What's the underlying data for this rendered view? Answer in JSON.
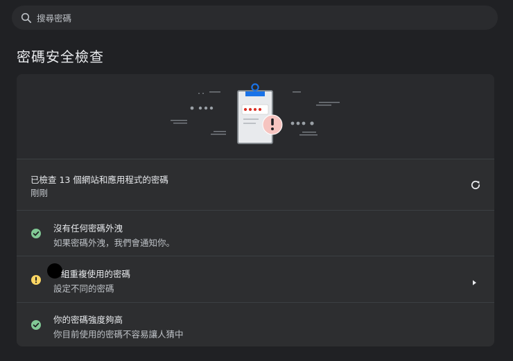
{
  "search": {
    "placeholder": "搜尋密碼",
    "icon": "search-icon"
  },
  "page_title": "密碼安全檢查",
  "summary": {
    "checked_text": "已檢查 13 個網站和應用程式的密碼",
    "time_text": "剛剛",
    "icon": "refresh-icon"
  },
  "items": [
    {
      "title": "沒有任何密碼外洩",
      "subtitle": "如果密碼外洩，我們會通知你。",
      "status": "ok",
      "icon": "check-circle-icon"
    },
    {
      "title": "組重複使用的密碼",
      "subtitle": "設定不同的密碼",
      "status": "warning",
      "icon": "warning-circle-icon"
    },
    {
      "title": "你的密碼強度夠高",
      "subtitle": "你目前使用的密碼不容易讓人猜中",
      "status": "ok",
      "icon": "check-circle-icon"
    }
  ],
  "colors": {
    "background": "#202124",
    "card": "#2d2e30",
    "ok": "#81c995",
    "warning": "#fdd663",
    "accent": "#1a73e8",
    "alert": "#d93025"
  }
}
